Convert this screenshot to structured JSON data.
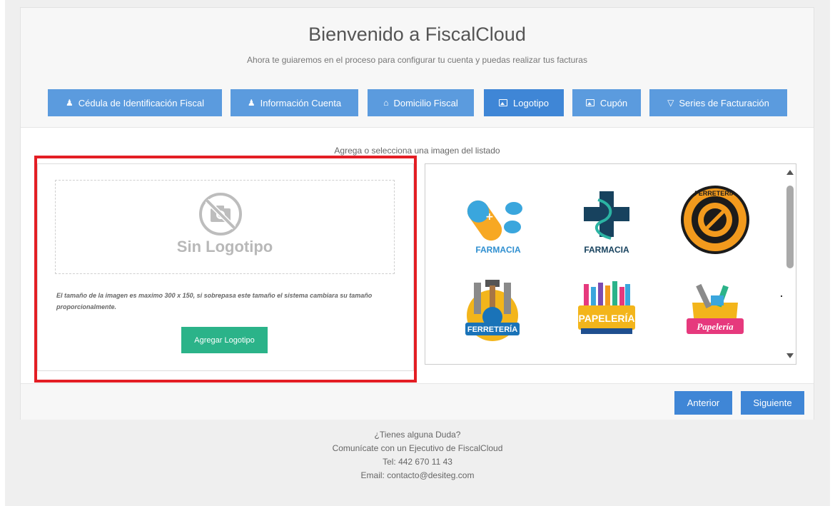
{
  "header": {
    "title": "Bienvenido a FiscalCloud",
    "subtitle": "Ahora te guiaremos en el proceso para configurar tu cuenta y puedas realizar tus facturas"
  },
  "tabs": [
    {
      "label": "Cédula de Identificación Fiscal",
      "icon": "user-icon"
    },
    {
      "label": "Información Cuenta",
      "icon": "user-icon"
    },
    {
      "label": "Domicilio Fiscal",
      "icon": "home-icon"
    },
    {
      "label": "Logotipo",
      "icon": "image-icon",
      "active": true
    },
    {
      "label": "Cupón",
      "icon": "image-icon"
    },
    {
      "label": "Series de Facturación",
      "icon": "bell-icon"
    }
  ],
  "main": {
    "instruction": "Agrega o selecciona una imagen del listado",
    "upload": {
      "placeholder_text": "Sin Logotipo",
      "size_note": "El tamaño de la imagen es maximo 300 x 150, si sobrepasa este tamaño el sistema cambiara su tamaño proporcionalmente.",
      "add_button": "Agregar Logotipo"
    },
    "gallery": {
      "logos": [
        {
          "name": "farmacia-pills-logo",
          "label": "FARMACIA"
        },
        {
          "name": "farmacia-cross-logo",
          "label": "FARMACIA"
        },
        {
          "name": "ferreteria-gear-logo",
          "label": "FERRETERIA"
        },
        {
          "name": "ferreteria-tools-logo",
          "label": "FERRETERÍA"
        },
        {
          "name": "papeleria-pencils-logo",
          "label": "PAPELERÍA"
        },
        {
          "name": "papeleria-box-logo",
          "label": "Papelería"
        }
      ]
    }
  },
  "footer": {
    "prev": "Anterior",
    "next": "Siguiente"
  },
  "help": {
    "question": "¿Tienes alguna Duda?",
    "contact": "Comunícate con un Ejecutivo de FiscalCloud",
    "phone": "Tel: 442 670 11 43",
    "email": "Email: contacto@desiteg.com"
  },
  "colors": {
    "tab": "#5b9bde",
    "tab_active": "#3f86d6",
    "success": "#2bb389",
    "highlight": "#e31e24"
  }
}
